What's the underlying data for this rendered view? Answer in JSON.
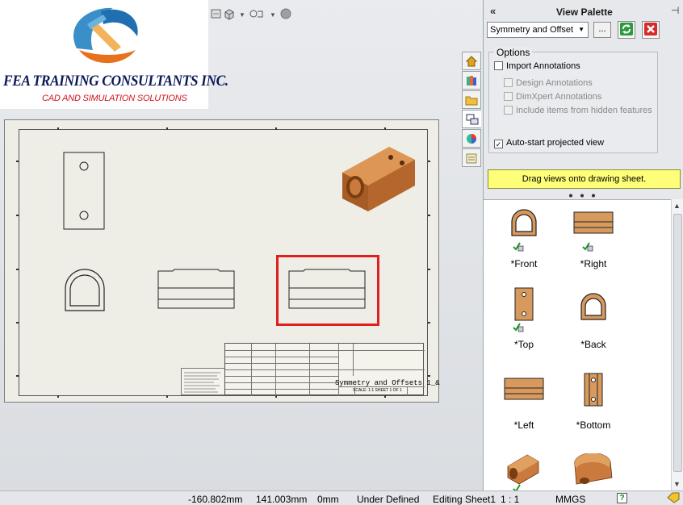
{
  "logo": {
    "title": "FEA TRAINING  CONSULTANTS INC.",
    "subtitle": "CAD AND SIMULATION SOLUTIONS"
  },
  "palette": {
    "title": "View Palette",
    "collapse_icon": "double-chevron-left-icon",
    "pin_icon": "pin-icon",
    "document_select": "Symmetry and Offset",
    "browse_label": "...",
    "options_legend": "Options",
    "options": [
      {
        "label": "Import Annotations",
        "checked": false,
        "enabled": true
      },
      {
        "label": "Design Annotations",
        "checked": false,
        "enabled": false
      },
      {
        "label": "DimXpert Annotations",
        "checked": false,
        "enabled": false
      },
      {
        "label": "Include items from hidden features",
        "checked": false,
        "enabled": false
      },
      {
        "label": "Auto-start projected view",
        "checked": true,
        "enabled": true
      }
    ],
    "drag_hint": "Drag views onto drawing sheet.",
    "views": [
      {
        "label": "*Front",
        "annotated": true
      },
      {
        "label": "*Right",
        "annotated": true
      },
      {
        "label": "*Top",
        "annotated": true
      },
      {
        "label": "*Back",
        "annotated": false
      },
      {
        "label": "*Left",
        "annotated": false
      },
      {
        "label": "*Bottom",
        "annotated": false
      },
      {
        "label": "",
        "annotated": true
      },
      {
        "label": "",
        "annotated": false
      }
    ]
  },
  "sheet": {
    "title_block_name": "Symmetry and Offsets 1_&",
    "title_block_sheet": "SCALE: 1:1   SHEET 1 OF 1"
  },
  "statusbar": {
    "x": "-160.802mm",
    "y": "141.003mm",
    "z": "0mm",
    "state": "Under Defined",
    "editing": "Editing Sheet1",
    "scale": "1 : 1",
    "units": "MMGS",
    "help": "?"
  },
  "colors": {
    "highlight_box": "#e02020",
    "part_copper": "#c97a3c",
    "hint_bg": "#fefe78"
  }
}
